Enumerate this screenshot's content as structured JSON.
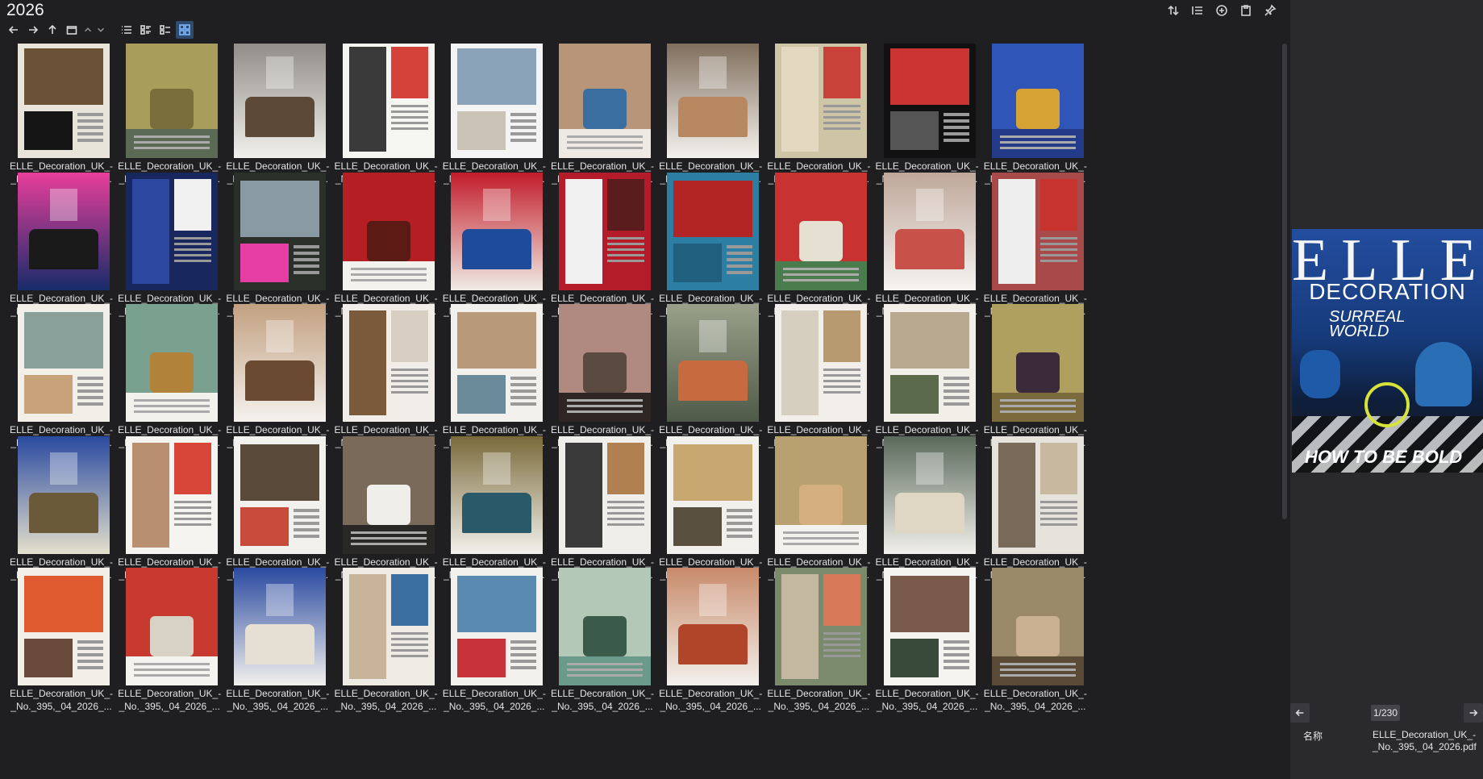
{
  "window": {
    "title": "2026"
  },
  "nav": {
    "back_icon": "arrow-left-icon",
    "forward_icon": "arrow-right-icon",
    "up_icon": "arrow-up-icon"
  },
  "colors": {
    "background": "#1f1f22",
    "preview_bg": "#2a2a2d",
    "active_view": "#2e4d6e"
  },
  "grid": {
    "caption_line1": "ELLE_Decoration_UK_-",
    "caption_line2": "_No._395,_04_2026_...",
    "rows": 5,
    "cols": 10
  },
  "thumbnails": [
    [
      "#e9e4da",
      "#6b5236",
      "#151515"
    ],
    [
      "#5a6a54",
      "#a89d5a",
      "#7a6f3c"
    ],
    [
      "#f2f0ec",
      "#8e8b86",
      "#5d4a36"
    ],
    [
      "#f5f5f2",
      "#3a3a3a",
      "#d4423a"
    ],
    [
      "#f4f4f4",
      "#8ba3b8",
      "#c9c2b5"
    ],
    [
      "#eeeae3",
      "#b89578",
      "#3a6ea0"
    ],
    [
      "#f4f2ee",
      "#7d6b59",
      "#b88860"
    ],
    [
      "#cec5a6",
      "#e3d9c1",
      "#c9423a"
    ],
    [
      "#111111",
      "#cc3333",
      "#555555"
    ],
    [
      "#243b8a",
      "#2f55b8",
      "#d6a233"
    ],
    [
      "#172b6a",
      "#e83e9a",
      "#1a1a1a"
    ],
    [
      "#18285e",
      "#2c48a0",
      "#f0f0f0"
    ],
    [
      "#2a2f2a",
      "#8a9aa5",
      "#e73ea5"
    ],
    [
      "#f4f2ef",
      "#b51e22",
      "#5b1a14"
    ],
    [
      "#f0ece6",
      "#c21c2a",
      "#1f4c9a"
    ],
    [
      "#b51c2a",
      "#f0f0f0",
      "#5a1c1c"
    ],
    [
      "#2c7ea3",
      "#b32525",
      "#205f7d"
    ],
    [
      "#4a7c4e",
      "#c83230",
      "#e6e0d2"
    ],
    [
      "#f6f4f1",
      "#bfa79a",
      "#c8524a"
    ],
    [
      "#a8494a",
      "#eeeeee",
      "#c73430"
    ],
    [
      "#f2efe8",
      "#8aa09a",
      "#c8a27a"
    ],
    [
      "#f3f1ec",
      "#7aa090",
      "#b0823a"
    ],
    [
      "#f4f2ee",
      "#c2a080",
      "#6a4a30"
    ],
    [
      "#f1eee9",
      "#7a5a3a",
      "#d8cfc2"
    ],
    [
      "#f3f1ed",
      "#b89a7a",
      "#6a8a9a"
    ],
    [
      "#2e2524",
      "#b08a80",
      "#5a4a40"
    ],
    [
      "#4e5a48",
      "#9aa08a",
      "#c86a40"
    ],
    [
      "#f2efea",
      "#d6cfc0",
      "#b89a70"
    ],
    [
      "#f2efe9",
      "#b8a890",
      "#5a6a4a"
    ],
    [
      "#7a6a3c",
      "#b0a060",
      "#3a2a3a"
    ],
    [
      "#e4e0cc",
      "#2a4aa0",
      "#6a5a3a"
    ],
    [
      "#f5f4f1",
      "#b89070",
      "#d8463a"
    ],
    [
      "#f3f1ee",
      "#5a4a3a",
      "#c84a3a"
    ],
    [
      "#2a2826",
      "#7a6a5a",
      "#f0eeea"
    ],
    [
      "#f3f1ec",
      "#7a6a3a",
      "#2a5a6a"
    ],
    [
      "#f0eeea",
      "#3a3a3a",
      "#b08050"
    ],
    [
      "#f2f0ec",
      "#c8a870",
      "#5a5040"
    ],
    [
      "#f4f2ee",
      "#b8a070",
      "#d4b080"
    ],
    [
      "#f2f0ec",
      "#5a6a5a",
      "#e0d6c4"
    ],
    [
      "#e6e2dc",
      "#7a6a5a",
      "#c8b8a0"
    ],
    [
      "#f2efe9",
      "#e05a30",
      "#6a4a3a"
    ],
    [
      "#f4f3f0",
      "#c83a30",
      "#d8d2c6"
    ],
    [
      "#f3f1ee",
      "#2a4aa0",
      "#e6e0d4"
    ],
    [
      "#eeeae4",
      "#c8b49a",
      "#3a6ea0"
    ],
    [
      "#f3f1ed",
      "#5a8ab0",
      "#c8323a"
    ],
    [
      "#6a9a8a",
      "#b4c8b8",
      "#3a5a4a"
    ],
    [
      "#f3f1ed",
      "#c88a6a",
      "#b0452a"
    ],
    [
      "#7a8a6a",
      "#c4b8a0",
      "#d87a5a"
    ],
    [
      "#f5f4f1",
      "#7a5a4a",
      "#3a4a3a"
    ],
    [
      "#5a4a36",
      "#9a8a6a",
      "#c8b090"
    ]
  ],
  "preview": {
    "masthead": "ELLE",
    "subtitle": "DECORATION",
    "tagline": "SURREAL WORLD",
    "cover_line": "HOW TO BE BOLD",
    "page_indicator": "1/230",
    "info_label": "名称",
    "info_value": "ELLE_Decoration_UK_-_No._395,_04_2026.pdf"
  }
}
